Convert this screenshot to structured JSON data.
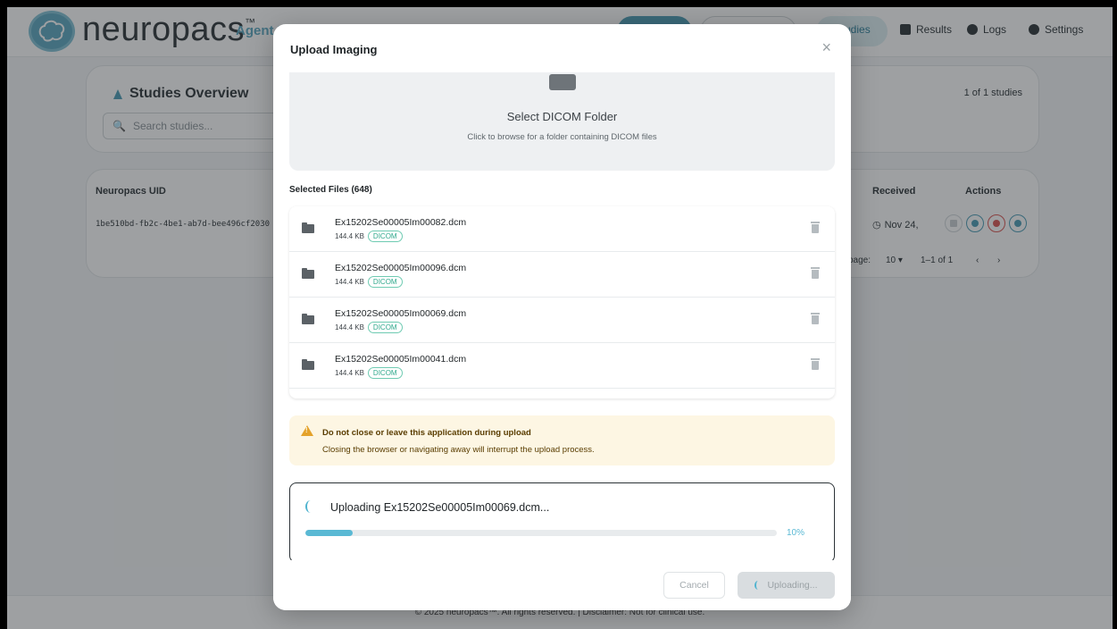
{
  "app": {
    "brand": "neuropacs",
    "brand_mark": "™",
    "agent_label": "Agent P",
    "nav": [
      {
        "label": "udies",
        "active": true
      },
      {
        "label": "Results"
      },
      {
        "label": "Logs"
      },
      {
        "label": "Settings"
      }
    ],
    "accent_color": "#5aa7c0"
  },
  "overview": {
    "title": "Studies Overview",
    "search_placeholder": "Search studies...",
    "count": "1 of 1 studies"
  },
  "table": {
    "columns": [
      "Neuropacs UID",
      "Received",
      "Actions"
    ],
    "row": {
      "uid": "1be510bd-fb2c-4be1-ab7d-bee496cf2030",
      "received": "Nov 24, "
    },
    "pager": {
      "rows_label": "page:",
      "rows_value": "10 ▾",
      "range": "1–1 of 1",
      "prev": "‹",
      "next": "›"
    }
  },
  "footer": {
    "text": "© 2025 neuropacs™. All rights reserved. | Disclaimer: Not for clinical use."
  },
  "modal": {
    "title": "Upload Imaging",
    "close": "×",
    "drop_zone": {
      "title": "Select DICOM Folder",
      "subtitle": "Click to browse for a folder containing DICOM files"
    },
    "selected_label": "Selected Files (648)",
    "files": [
      {
        "name": "Ex15202Se00005Im00082.dcm",
        "size": "144.4 KB",
        "type": "DICOM"
      },
      {
        "name": "Ex15202Se00005Im00096.dcm",
        "size": "144.4 KB",
        "type": "DICOM"
      },
      {
        "name": "Ex15202Se00005Im00069.dcm",
        "size": "144.4 KB",
        "type": "DICOM"
      },
      {
        "name": "Ex15202Se00005Im00041.dcm",
        "size": "144.4 KB",
        "type": "DICOM"
      }
    ],
    "warning": {
      "title": "Do not close or leave this application during upload",
      "text": "Closing the browser or navigating away will interrupt the upload process.",
      "color": "#e4a22a"
    },
    "progress": {
      "label": "Uploading Ex15202Se00005Im00069.dcm...",
      "percent": 10,
      "percent_label": "10%",
      "color": "#5ab9d4"
    },
    "buttons": {
      "cancel": "Cancel",
      "upload": "Uploading..."
    }
  }
}
